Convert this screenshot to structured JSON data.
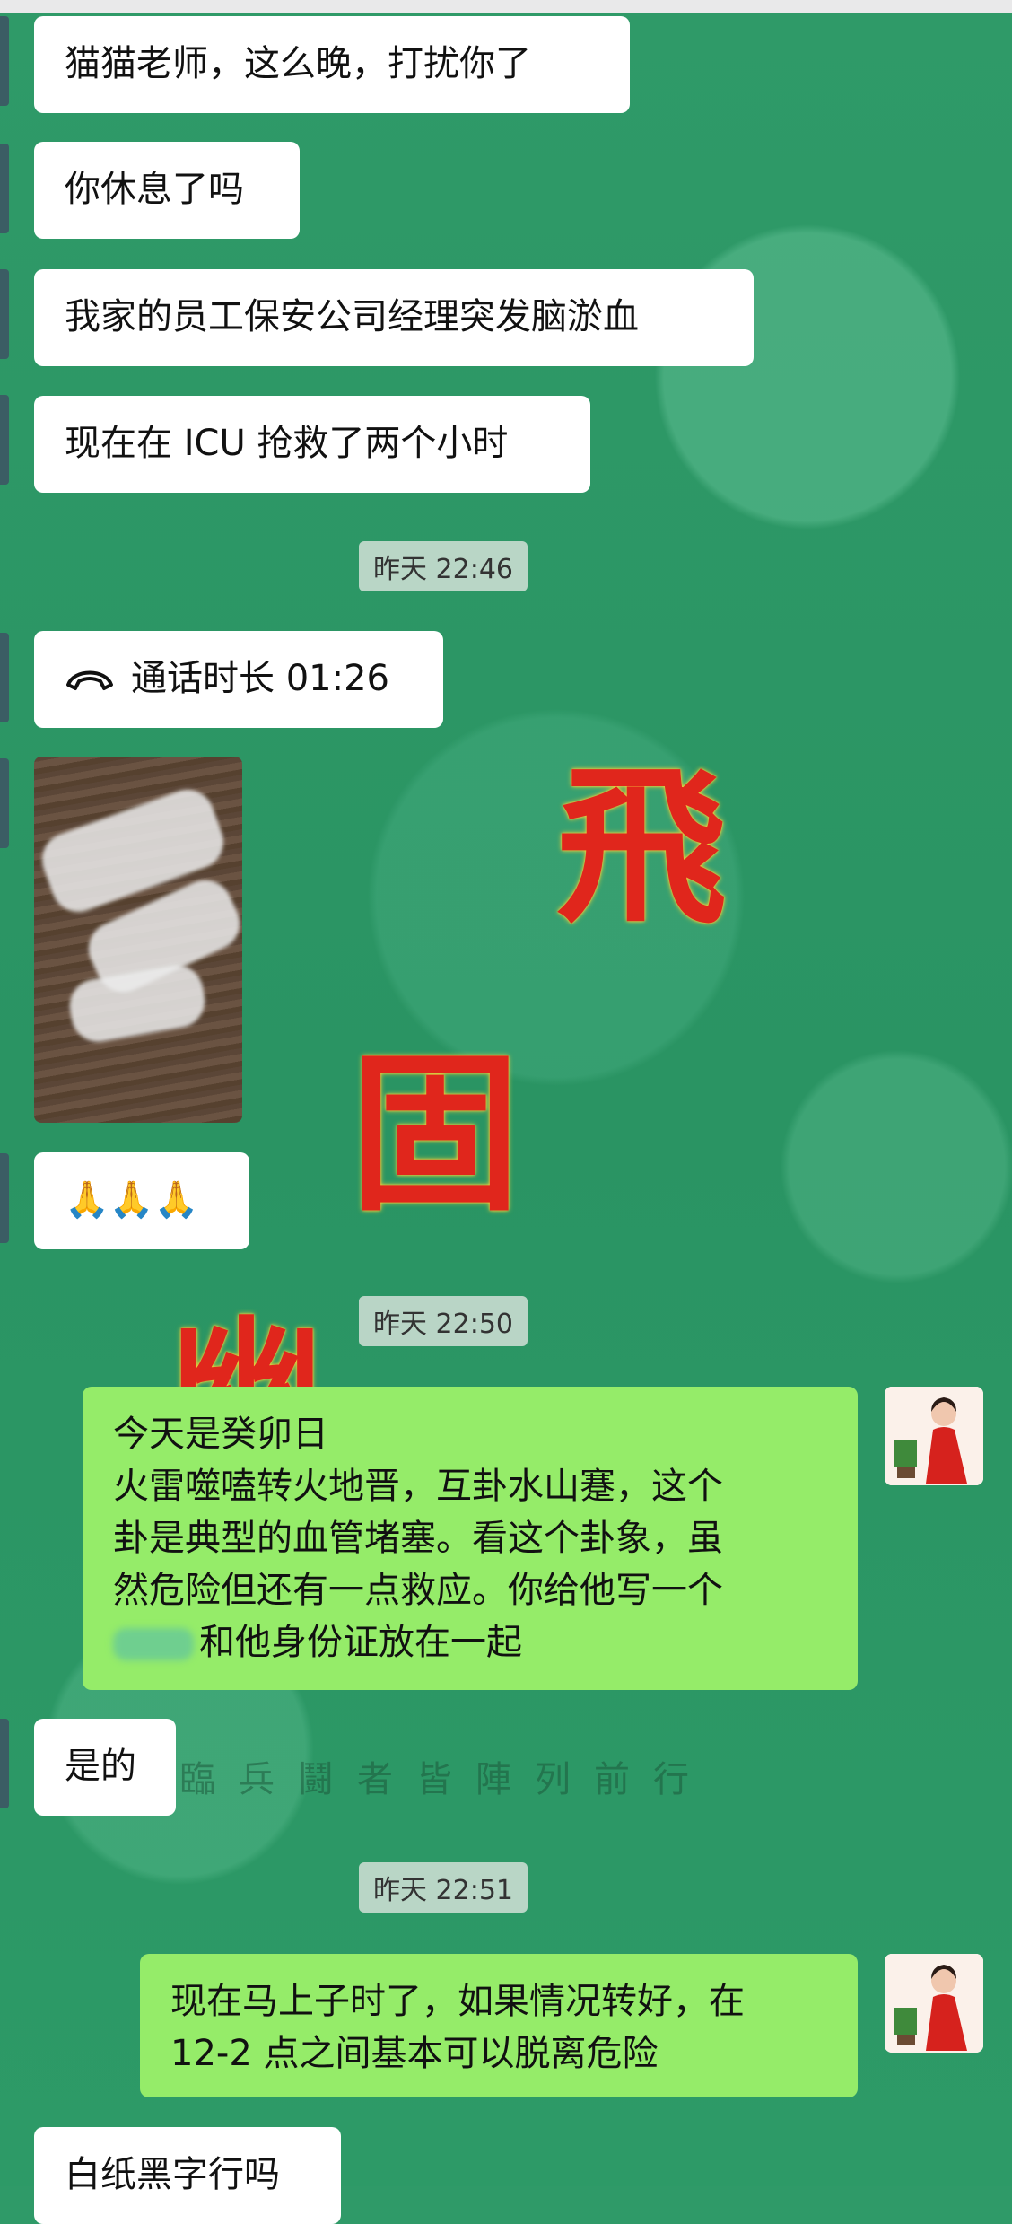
{
  "messages": {
    "m1": "猫猫老师，这么晚，打扰你了",
    "m2": "你休息了吗",
    "m3": "我家的员工保安公司经理突发脑淤血",
    "m4": "现在在 ICU 抢救了两个小时",
    "call": "通话时长 01:26",
    "emoji": "🙏🙏🙏",
    "r1_line1": "今天是癸卯日",
    "r1_line2": "火雷噬嗑转火地晋，互卦水山蹇，这个",
    "r1_line3": "卦是典型的血管堵塞。看这个卦象，虽",
    "r1_line4": "然危险但还有一点救应。你给他写一个",
    "r1_line5": "和他身份证放在一起",
    "m5": "是的",
    "r2_line1": "现在马上子时了，如果情况转好，在",
    "r2_line2": "12-2 点之间基本可以脱离危险",
    "m6": "白纸黑字行吗"
  },
  "timestamps": {
    "t1": "昨天 22:46",
    "t2": "昨天 22:50",
    "t3": "昨天 22:51"
  },
  "background": {
    "row_text": "臨兵鬪者皆陣列前行",
    "seal_1": "飛",
    "seal_2": "固",
    "seal_3": "幽"
  },
  "colors": {
    "background": "#2f9a68",
    "incoming_bubble": "#ffffff",
    "outgoing_bubble": "#95ec69",
    "seal_red": "#e0261c"
  }
}
